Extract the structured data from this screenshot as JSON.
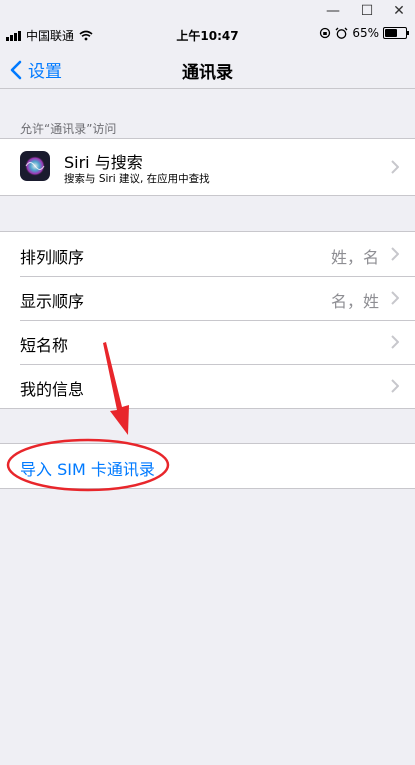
{
  "status": {
    "carrier": "中国联通",
    "time": "上午10:47",
    "battery": "65%",
    "battery_level": 0.65
  },
  "nav": {
    "back_label": "设置",
    "title": "通讯录"
  },
  "section_header": "允许“通讯录”访问",
  "siri": {
    "title": "Siri 与搜索",
    "subtitle": "搜索与 Siri 建议, 在应用中查找"
  },
  "settings": [
    {
      "label": "排列顺序",
      "value": "姓，名"
    },
    {
      "label": "显示顺序",
      "value": "名，姓"
    },
    {
      "label": "短名称",
      "value": ""
    },
    {
      "label": "我的信息",
      "value": ""
    }
  ],
  "import_label": "导入 SIM 卡通讯录",
  "colors": {
    "accent": "#007aff",
    "background": "#efeff4",
    "annotation": "#e8262b"
  }
}
